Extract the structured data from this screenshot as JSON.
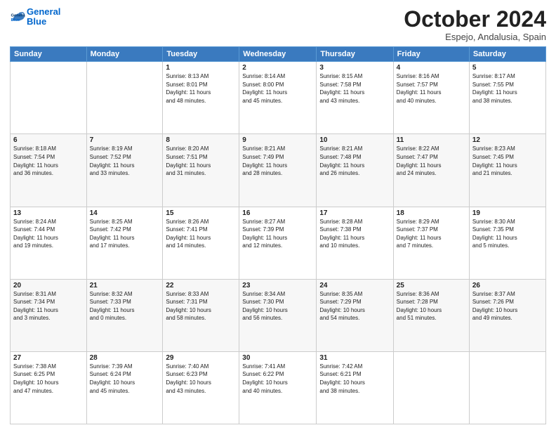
{
  "header": {
    "logo_line1": "General",
    "logo_line2": "Blue",
    "month": "October 2024",
    "location": "Espejo, Andalusia, Spain"
  },
  "days_of_week": [
    "Sunday",
    "Monday",
    "Tuesday",
    "Wednesday",
    "Thursday",
    "Friday",
    "Saturday"
  ],
  "weeks": [
    [
      {
        "day": "",
        "info": ""
      },
      {
        "day": "",
        "info": ""
      },
      {
        "day": "1",
        "info": "Sunrise: 8:13 AM\nSunset: 8:01 PM\nDaylight: 11 hours\nand 48 minutes."
      },
      {
        "day": "2",
        "info": "Sunrise: 8:14 AM\nSunset: 8:00 PM\nDaylight: 11 hours\nand 45 minutes."
      },
      {
        "day": "3",
        "info": "Sunrise: 8:15 AM\nSunset: 7:58 PM\nDaylight: 11 hours\nand 43 minutes."
      },
      {
        "day": "4",
        "info": "Sunrise: 8:16 AM\nSunset: 7:57 PM\nDaylight: 11 hours\nand 40 minutes."
      },
      {
        "day": "5",
        "info": "Sunrise: 8:17 AM\nSunset: 7:55 PM\nDaylight: 11 hours\nand 38 minutes."
      }
    ],
    [
      {
        "day": "6",
        "info": "Sunrise: 8:18 AM\nSunset: 7:54 PM\nDaylight: 11 hours\nand 36 minutes."
      },
      {
        "day": "7",
        "info": "Sunrise: 8:19 AM\nSunset: 7:52 PM\nDaylight: 11 hours\nand 33 minutes."
      },
      {
        "day": "8",
        "info": "Sunrise: 8:20 AM\nSunset: 7:51 PM\nDaylight: 11 hours\nand 31 minutes."
      },
      {
        "day": "9",
        "info": "Sunrise: 8:21 AM\nSunset: 7:49 PM\nDaylight: 11 hours\nand 28 minutes."
      },
      {
        "day": "10",
        "info": "Sunrise: 8:21 AM\nSunset: 7:48 PM\nDaylight: 11 hours\nand 26 minutes."
      },
      {
        "day": "11",
        "info": "Sunrise: 8:22 AM\nSunset: 7:47 PM\nDaylight: 11 hours\nand 24 minutes."
      },
      {
        "day": "12",
        "info": "Sunrise: 8:23 AM\nSunset: 7:45 PM\nDaylight: 11 hours\nand 21 minutes."
      }
    ],
    [
      {
        "day": "13",
        "info": "Sunrise: 8:24 AM\nSunset: 7:44 PM\nDaylight: 11 hours\nand 19 minutes."
      },
      {
        "day": "14",
        "info": "Sunrise: 8:25 AM\nSunset: 7:42 PM\nDaylight: 11 hours\nand 17 minutes."
      },
      {
        "day": "15",
        "info": "Sunrise: 8:26 AM\nSunset: 7:41 PM\nDaylight: 11 hours\nand 14 minutes."
      },
      {
        "day": "16",
        "info": "Sunrise: 8:27 AM\nSunset: 7:39 PM\nDaylight: 11 hours\nand 12 minutes."
      },
      {
        "day": "17",
        "info": "Sunrise: 8:28 AM\nSunset: 7:38 PM\nDaylight: 11 hours\nand 10 minutes."
      },
      {
        "day": "18",
        "info": "Sunrise: 8:29 AM\nSunset: 7:37 PM\nDaylight: 11 hours\nand 7 minutes."
      },
      {
        "day": "19",
        "info": "Sunrise: 8:30 AM\nSunset: 7:35 PM\nDaylight: 11 hours\nand 5 minutes."
      }
    ],
    [
      {
        "day": "20",
        "info": "Sunrise: 8:31 AM\nSunset: 7:34 PM\nDaylight: 11 hours\nand 3 minutes."
      },
      {
        "day": "21",
        "info": "Sunrise: 8:32 AM\nSunset: 7:33 PM\nDaylight: 11 hours\nand 0 minutes."
      },
      {
        "day": "22",
        "info": "Sunrise: 8:33 AM\nSunset: 7:31 PM\nDaylight: 10 hours\nand 58 minutes."
      },
      {
        "day": "23",
        "info": "Sunrise: 8:34 AM\nSunset: 7:30 PM\nDaylight: 10 hours\nand 56 minutes."
      },
      {
        "day": "24",
        "info": "Sunrise: 8:35 AM\nSunset: 7:29 PM\nDaylight: 10 hours\nand 54 minutes."
      },
      {
        "day": "25",
        "info": "Sunrise: 8:36 AM\nSunset: 7:28 PM\nDaylight: 10 hours\nand 51 minutes."
      },
      {
        "day": "26",
        "info": "Sunrise: 8:37 AM\nSunset: 7:26 PM\nDaylight: 10 hours\nand 49 minutes."
      }
    ],
    [
      {
        "day": "27",
        "info": "Sunrise: 7:38 AM\nSunset: 6:25 PM\nDaylight: 10 hours\nand 47 minutes."
      },
      {
        "day": "28",
        "info": "Sunrise: 7:39 AM\nSunset: 6:24 PM\nDaylight: 10 hours\nand 45 minutes."
      },
      {
        "day": "29",
        "info": "Sunrise: 7:40 AM\nSunset: 6:23 PM\nDaylight: 10 hours\nand 43 minutes."
      },
      {
        "day": "30",
        "info": "Sunrise: 7:41 AM\nSunset: 6:22 PM\nDaylight: 10 hours\nand 40 minutes."
      },
      {
        "day": "31",
        "info": "Sunrise: 7:42 AM\nSunset: 6:21 PM\nDaylight: 10 hours\nand 38 minutes."
      },
      {
        "day": "",
        "info": ""
      },
      {
        "day": "",
        "info": ""
      }
    ]
  ]
}
